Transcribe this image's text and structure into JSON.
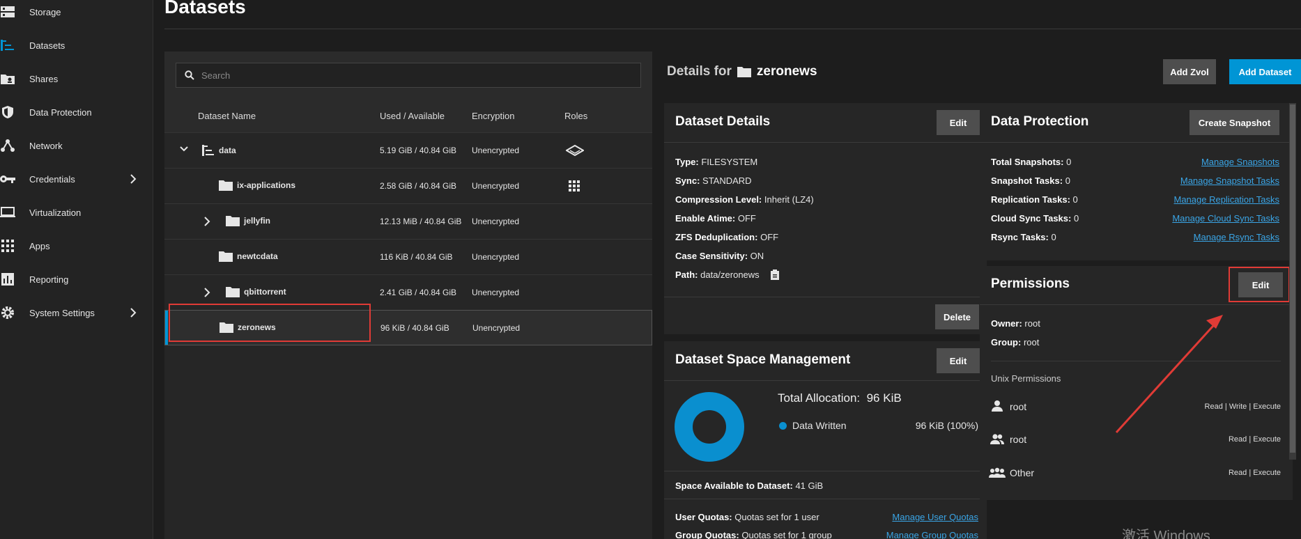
{
  "sidebar": {
    "items": [
      {
        "label": "Storage",
        "icon": "storage-icon"
      },
      {
        "label": "Datasets",
        "icon": "datasets-icon"
      },
      {
        "label": "Shares",
        "icon": "shares-icon"
      },
      {
        "label": "Data Protection",
        "icon": "shield-icon"
      },
      {
        "label": "Network",
        "icon": "network-icon"
      },
      {
        "label": "Credentials",
        "icon": "key-icon",
        "expandable": true
      },
      {
        "label": "Virtualization",
        "icon": "laptop-icon"
      },
      {
        "label": "Apps",
        "icon": "apps-grid-icon"
      },
      {
        "label": "Reporting",
        "icon": "chart-icon"
      },
      {
        "label": "System Settings",
        "icon": "gear-icon",
        "expandable": true
      }
    ]
  },
  "page": {
    "title": "Datasets"
  },
  "search": {
    "placeholder": "Search"
  },
  "table": {
    "headers": {
      "name": "Dataset Name",
      "used": "Used / Available",
      "encryption": "Encryption",
      "roles": "Roles"
    },
    "rows": [
      {
        "name": "data",
        "used": "5.19 GiB / 40.84 GiB",
        "encryption": "Unencrypted",
        "role_icon": "stack-icon"
      },
      {
        "name": "ix-applications",
        "used": "2.58 GiB / 40.84 GiB",
        "encryption": "Unencrypted",
        "role_icon": "apps-grid-icon"
      },
      {
        "name": "jellyfin",
        "used": "12.13 MiB / 40.84 GiB",
        "encryption": "Unencrypted"
      },
      {
        "name": "newtcdata",
        "used": "116 KiB / 40.84 GiB",
        "encryption": "Unencrypted"
      },
      {
        "name": "qbittorrent",
        "used": "2.41 GiB / 40.84 GiB",
        "encryption": "Unencrypted"
      },
      {
        "name": "zeronews",
        "used": "96 KiB / 40.84 GiB",
        "encryption": "Unencrypted"
      }
    ]
  },
  "details_header": {
    "prefix": "Details for",
    "name": "zeronews"
  },
  "buttons": {
    "add_zvol": "Add Zvol",
    "add_dataset": "Add Dataset"
  },
  "dataset_details": {
    "title": "Dataset Details",
    "edit": "Edit",
    "delete": "Delete",
    "fields": [
      {
        "k": "Type:",
        "v": "FILESYSTEM"
      },
      {
        "k": "Sync:",
        "v": "STANDARD"
      },
      {
        "k": "Compression Level:",
        "v": "Inherit (LZ4)"
      },
      {
        "k": "Enable Atime:",
        "v": "OFF"
      },
      {
        "k": "ZFS Deduplication:",
        "v": "OFF"
      },
      {
        "k": "Case Sensitivity:",
        "v": "ON"
      },
      {
        "k": "Path:",
        "v": "data/zeronews"
      }
    ]
  },
  "space": {
    "title": "Dataset Space Management",
    "edit": "Edit",
    "total_label": "Total Allocation:",
    "total_value": "96 KiB",
    "legend_label": "Data Written",
    "legend_value": "96 KiB (100%)",
    "available_label": "Space Available to Dataset:",
    "available_value": "41 GiB",
    "user_quotas_label": "User Quotas:",
    "user_quotas_value": "Quotas set for 1 user",
    "user_quotas_link": "Manage User Quotas",
    "group_quotas_label": "Group Quotas:",
    "group_quotas_value": "Quotas set for 1 group",
    "group_quotas_link": "Manage Group Quotas",
    "accent": "#0a8fcf"
  },
  "protection": {
    "title": "Data Protection",
    "create_snapshot": "Create Snapshot",
    "rows": [
      {
        "k": "Total Snapshots:",
        "v": "0",
        "link": "Manage Snapshots"
      },
      {
        "k": "Snapshot Tasks:",
        "v": "0",
        "link": "Manage Snapshot Tasks"
      },
      {
        "k": "Replication Tasks:",
        "v": "0",
        "link": "Manage Replication Tasks"
      },
      {
        "k": "Cloud Sync Tasks:",
        "v": "0",
        "link": "Manage Cloud Sync Tasks"
      },
      {
        "k": "Rsync Tasks:",
        "v": "0",
        "link": "Manage Rsync Tasks"
      }
    ]
  },
  "permissions": {
    "title": "Permissions",
    "edit": "Edit",
    "owner_label": "Owner:",
    "owner_value": "root",
    "group_label": "Group:",
    "group_value": "root",
    "unix_title": "Unix Permissions",
    "entries": [
      {
        "name": "root",
        "perms": "Read | Write | Execute",
        "icon": "user-icon"
      },
      {
        "name": "root",
        "perms": "Read | Execute",
        "icon": "group-icon"
      },
      {
        "name": "Other",
        "perms": "Read | Execute",
        "icon": "others-icon"
      }
    ]
  },
  "watermark": "激活 Windows"
}
